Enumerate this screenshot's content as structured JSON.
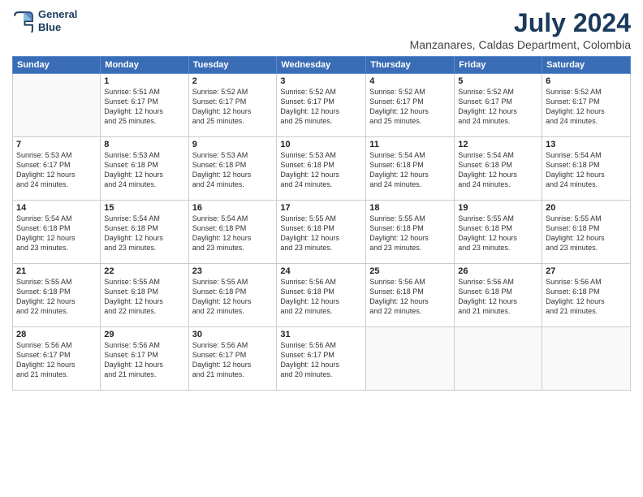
{
  "header": {
    "logo_line1": "General",
    "logo_line2": "Blue",
    "title": "July 2024",
    "subtitle": "Manzanares, Caldas Department, Colombia"
  },
  "calendar": {
    "days_of_week": [
      "Sunday",
      "Monday",
      "Tuesday",
      "Wednesday",
      "Thursday",
      "Friday",
      "Saturday"
    ],
    "weeks": [
      [
        {
          "day": "",
          "info": ""
        },
        {
          "day": "1",
          "info": "Sunrise: 5:51 AM\nSunset: 6:17 PM\nDaylight: 12 hours\nand 25 minutes."
        },
        {
          "day": "2",
          "info": "Sunrise: 5:52 AM\nSunset: 6:17 PM\nDaylight: 12 hours\nand 25 minutes."
        },
        {
          "day": "3",
          "info": "Sunrise: 5:52 AM\nSunset: 6:17 PM\nDaylight: 12 hours\nand 25 minutes."
        },
        {
          "day": "4",
          "info": "Sunrise: 5:52 AM\nSunset: 6:17 PM\nDaylight: 12 hours\nand 25 minutes."
        },
        {
          "day": "5",
          "info": "Sunrise: 5:52 AM\nSunset: 6:17 PM\nDaylight: 12 hours\nand 24 minutes."
        },
        {
          "day": "6",
          "info": "Sunrise: 5:52 AM\nSunset: 6:17 PM\nDaylight: 12 hours\nand 24 minutes."
        }
      ],
      [
        {
          "day": "7",
          "info": "Sunrise: 5:53 AM\nSunset: 6:17 PM\nDaylight: 12 hours\nand 24 minutes."
        },
        {
          "day": "8",
          "info": "Sunrise: 5:53 AM\nSunset: 6:18 PM\nDaylight: 12 hours\nand 24 minutes."
        },
        {
          "day": "9",
          "info": "Sunrise: 5:53 AM\nSunset: 6:18 PM\nDaylight: 12 hours\nand 24 minutes."
        },
        {
          "day": "10",
          "info": "Sunrise: 5:53 AM\nSunset: 6:18 PM\nDaylight: 12 hours\nand 24 minutes."
        },
        {
          "day": "11",
          "info": "Sunrise: 5:54 AM\nSunset: 6:18 PM\nDaylight: 12 hours\nand 24 minutes."
        },
        {
          "day": "12",
          "info": "Sunrise: 5:54 AM\nSunset: 6:18 PM\nDaylight: 12 hours\nand 24 minutes."
        },
        {
          "day": "13",
          "info": "Sunrise: 5:54 AM\nSunset: 6:18 PM\nDaylight: 12 hours\nand 24 minutes."
        }
      ],
      [
        {
          "day": "14",
          "info": "Sunrise: 5:54 AM\nSunset: 6:18 PM\nDaylight: 12 hours\nand 23 minutes."
        },
        {
          "day": "15",
          "info": "Sunrise: 5:54 AM\nSunset: 6:18 PM\nDaylight: 12 hours\nand 23 minutes."
        },
        {
          "day": "16",
          "info": "Sunrise: 5:54 AM\nSunset: 6:18 PM\nDaylight: 12 hours\nand 23 minutes."
        },
        {
          "day": "17",
          "info": "Sunrise: 5:55 AM\nSunset: 6:18 PM\nDaylight: 12 hours\nand 23 minutes."
        },
        {
          "day": "18",
          "info": "Sunrise: 5:55 AM\nSunset: 6:18 PM\nDaylight: 12 hours\nand 23 minutes."
        },
        {
          "day": "19",
          "info": "Sunrise: 5:55 AM\nSunset: 6:18 PM\nDaylight: 12 hours\nand 23 minutes."
        },
        {
          "day": "20",
          "info": "Sunrise: 5:55 AM\nSunset: 6:18 PM\nDaylight: 12 hours\nand 23 minutes."
        }
      ],
      [
        {
          "day": "21",
          "info": "Sunrise: 5:55 AM\nSunset: 6:18 PM\nDaylight: 12 hours\nand 22 minutes."
        },
        {
          "day": "22",
          "info": "Sunrise: 5:55 AM\nSunset: 6:18 PM\nDaylight: 12 hours\nand 22 minutes."
        },
        {
          "day": "23",
          "info": "Sunrise: 5:55 AM\nSunset: 6:18 PM\nDaylight: 12 hours\nand 22 minutes."
        },
        {
          "day": "24",
          "info": "Sunrise: 5:56 AM\nSunset: 6:18 PM\nDaylight: 12 hours\nand 22 minutes."
        },
        {
          "day": "25",
          "info": "Sunrise: 5:56 AM\nSunset: 6:18 PM\nDaylight: 12 hours\nand 22 minutes."
        },
        {
          "day": "26",
          "info": "Sunrise: 5:56 AM\nSunset: 6:18 PM\nDaylight: 12 hours\nand 21 minutes."
        },
        {
          "day": "27",
          "info": "Sunrise: 5:56 AM\nSunset: 6:18 PM\nDaylight: 12 hours\nand 21 minutes."
        }
      ],
      [
        {
          "day": "28",
          "info": "Sunrise: 5:56 AM\nSunset: 6:17 PM\nDaylight: 12 hours\nand 21 minutes."
        },
        {
          "day": "29",
          "info": "Sunrise: 5:56 AM\nSunset: 6:17 PM\nDaylight: 12 hours\nand 21 minutes."
        },
        {
          "day": "30",
          "info": "Sunrise: 5:56 AM\nSunset: 6:17 PM\nDaylight: 12 hours\nand 21 minutes."
        },
        {
          "day": "31",
          "info": "Sunrise: 5:56 AM\nSunset: 6:17 PM\nDaylight: 12 hours\nand 20 minutes."
        },
        {
          "day": "",
          "info": ""
        },
        {
          "day": "",
          "info": ""
        },
        {
          "day": "",
          "info": ""
        }
      ]
    ]
  }
}
